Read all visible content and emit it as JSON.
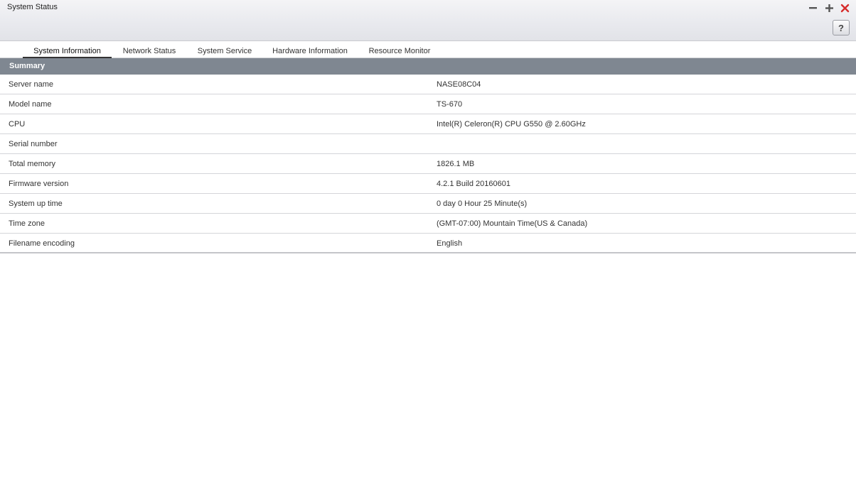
{
  "window": {
    "title": "System Status",
    "help_label": "?",
    "controls": [
      "minimize-icon",
      "maximize-icon",
      "close-icon"
    ],
    "close_color": "#d62b2b"
  },
  "tabs": [
    {
      "label": "System Information",
      "active": true
    },
    {
      "label": "Network Status",
      "active": false
    },
    {
      "label": "System Service",
      "active": false
    },
    {
      "label": "Hardware Information",
      "active": false
    },
    {
      "label": "Resource Monitor",
      "active": false
    }
  ],
  "summary": {
    "header": "Summary",
    "rows": [
      {
        "label": "Server name",
        "value": "NASE08C04"
      },
      {
        "label": "Model name",
        "value": "TS-670"
      },
      {
        "label": "CPU",
        "value": "Intel(R) Celeron(R) CPU G550 @ 2.60GHz"
      },
      {
        "label": "Serial number",
        "value": ""
      },
      {
        "label": "Total memory",
        "value": "1826.1 MB"
      },
      {
        "label": "Firmware version",
        "value": "4.2.1 Build 20160601"
      },
      {
        "label": "System up time",
        "value": "0 day 0 Hour 25 Minute(s)"
      },
      {
        "label": "Time zone",
        "value": "(GMT-07:00) Mountain Time(US & Canada)"
      },
      {
        "label": "Filename encoding",
        "value": "English"
      }
    ]
  },
  "colors": {
    "header_bar": "#7f8791",
    "active_tab_underline": "#333333"
  }
}
